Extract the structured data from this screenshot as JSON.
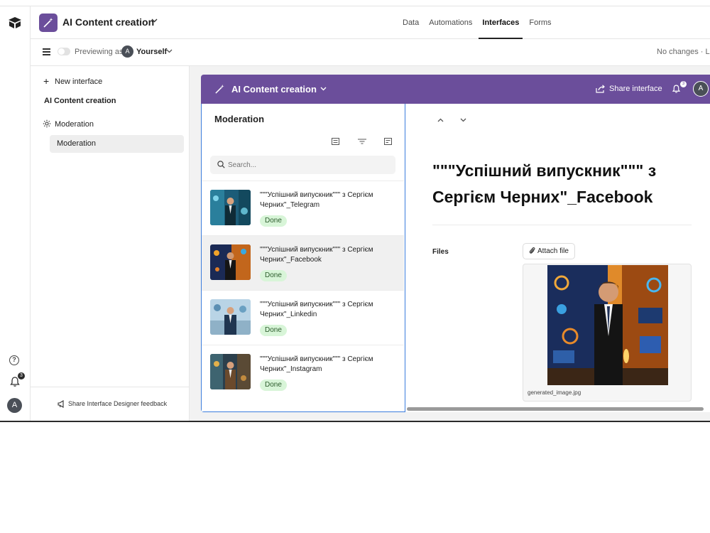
{
  "header": {
    "app_title": "AI Content creation",
    "nav": [
      "Data",
      "Automations",
      "Interfaces",
      "Forms"
    ],
    "active_nav": "Interfaces"
  },
  "subheader": {
    "previewing_label": "Previewing as",
    "avatar_initial": "A",
    "user_name": "Yourself",
    "status": "No changes · Las"
  },
  "sidebar": {
    "new_interface": "New interface",
    "section": "AI Content creation",
    "group": "Moderation",
    "item": "Moderation",
    "feedback": "Share Interface Designer feedback"
  },
  "rail": {
    "notification_count": "3",
    "avatar_initial": "A"
  },
  "interface": {
    "title": "AI Content creation",
    "share_label": "Share interface",
    "notification_count": "3",
    "avatar_initial": "A",
    "accent_color": "#6b4e9b"
  },
  "list": {
    "title": "Moderation",
    "search_placeholder": "Search...",
    "rows": [
      {
        "title": "\"\"\"Успішний випускник\"\"\" з Сергієм Черних\"_Telegram",
        "status": "Done"
      },
      {
        "title": "\"\"\"Успішний випускник\"\"\" з Сергієм Черних\"_Facebook",
        "status": "Done"
      },
      {
        "title": "\"\"\"Успішний випускник\"\"\" з Сергієм Черних\"_Linkedin",
        "status": "Done"
      },
      {
        "title": "\"\"\"Успішний випускник\"\"\" з Сергієм Черних\"_Instagram",
        "status": "Done"
      }
    ]
  },
  "detail": {
    "title": "\"\"\"Успішний випускник\"\"\" з Сергієм Черних\"_Facebook",
    "files_label": "Files",
    "attach_label": "Attach file",
    "file_name": "generated_image.jpg"
  }
}
